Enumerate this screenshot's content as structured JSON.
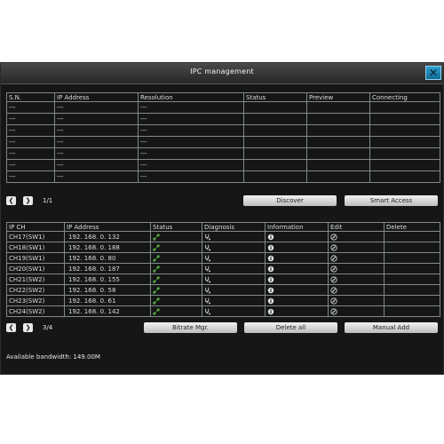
{
  "window": {
    "title": "IPC management",
    "close_glyph": "✕"
  },
  "top_table": {
    "headers": [
      "S.N.",
      "IP Address",
      "Resolution",
      "Status",
      "Preview",
      "Connecting"
    ],
    "rows": [
      [
        "---",
        "---",
        "---",
        "",
        "",
        ""
      ],
      [
        "---",
        "---",
        "---",
        "",
        "",
        ""
      ],
      [
        "---",
        "---",
        "---",
        "",
        "",
        ""
      ],
      [
        "---",
        "---",
        "---",
        "",
        "",
        ""
      ],
      [
        "---",
        "---",
        "---",
        "",
        "",
        ""
      ],
      [
        "---",
        "---",
        "---",
        "",
        "",
        ""
      ],
      [
        "---",
        "---",
        "---",
        "",
        "",
        ""
      ]
    ],
    "page": "1/1",
    "discover_label": "Discover",
    "smart_access_label": "Smart Access"
  },
  "channel_table": {
    "headers": [
      "IP CH",
      "IP Address",
      "Status",
      "Diagnosis",
      "Information",
      "Edit",
      "Delete"
    ],
    "rows": [
      {
        "ch": "CH17(SW1)",
        "ip": "192. 168. 0. 132"
      },
      {
        "ch": "CH18(SW1)",
        "ip": "192. 168. 0. 188"
      },
      {
        "ch": "CH19(SW1)",
        "ip": "192. 168. 0. 80"
      },
      {
        "ch": "CH20(SW1)",
        "ip": "192. 168. 0. 187"
      },
      {
        "ch": "CH21(SW2)",
        "ip": "192. 168. 0. 155"
      },
      {
        "ch": "CH22(SW2)",
        "ip": "192. 168. 0. 58"
      },
      {
        "ch": "CH23(SW2)",
        "ip": "192. 168. 0. 61"
      },
      {
        "ch": "CH24(SW2)",
        "ip": "192. 168. 0. 142"
      }
    ],
    "icons": {
      "status": "link-icon",
      "diagnosis": "stethoscope-icon",
      "information": "info-icon",
      "edit": "edit-icon"
    },
    "page": "3/4",
    "bitrate_label": "Bitrate Mgr.",
    "delete_all_label": "Delete  all",
    "manual_add_label": "Manual Add"
  },
  "bandwidth_text": "Available bandwidth: 149.00M",
  "colors": {
    "background": "#161616",
    "grid_line": "#7f8a8c",
    "status_icon": "#5fc24a",
    "close_button": "#1a86b8"
  }
}
